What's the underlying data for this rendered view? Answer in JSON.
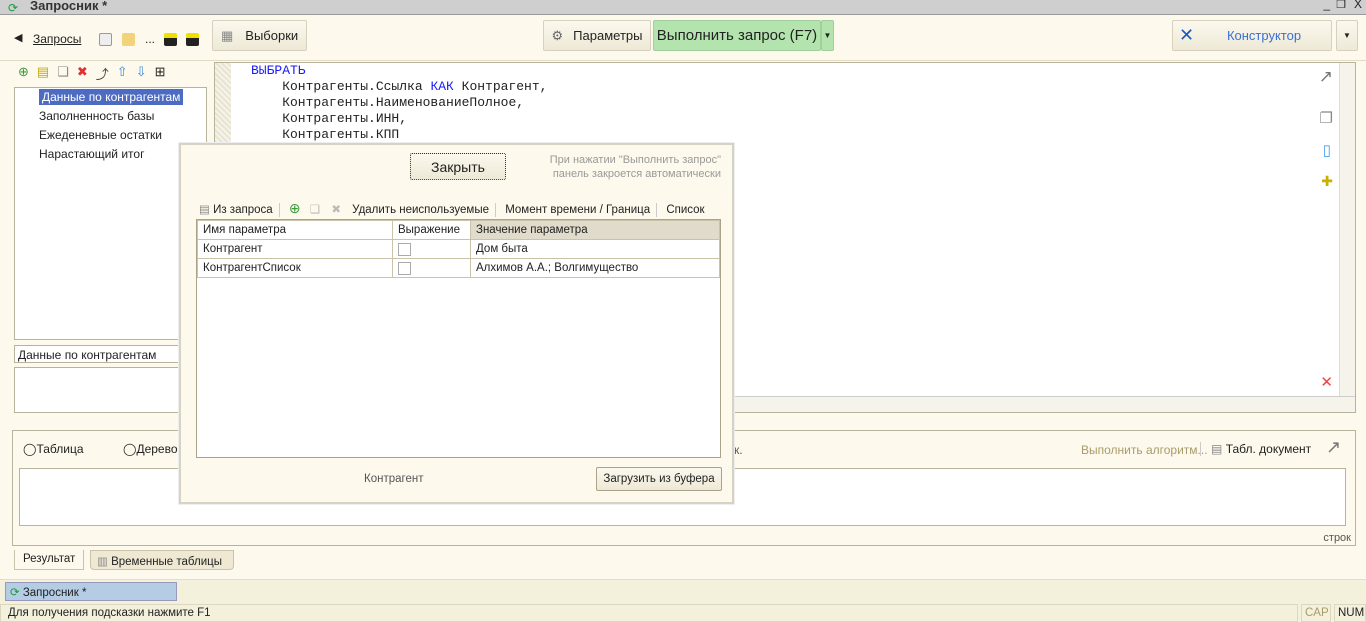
{
  "window": {
    "title": "Запросник *"
  },
  "toolbar": {
    "back_label": "Запросы",
    "dots": "...",
    "samples_label": "Выборки",
    "params_label": "Параметры",
    "run_label": "Выполнить запрос (F7)",
    "constructor_label": "Конструктор"
  },
  "tree": {
    "items": [
      "Данные по контрагентам",
      "Заполненность базы",
      "Ежеденевные остатки",
      "Нарастающий итог"
    ]
  },
  "query_name": "Данные по контрагентам",
  "editor": {
    "lines": [
      {
        "a": "ВЫБРАТЬ",
        "b": "",
        "c": ""
      },
      {
        "a": "    Контрагенты.Ссылка ",
        "b": "КАК",
        "c": " Контрагент,"
      },
      {
        "a": "    Контрагенты.НаименованиеПолное,",
        "b": "",
        "c": ""
      },
      {
        "a": "    Контрагенты.ИНН,",
        "b": "",
        "c": ""
      },
      {
        "a": "    Контрагенты.КПП",
        "b": "",
        "c": ""
      }
    ]
  },
  "result": {
    "radio_table": "Таблица",
    "radio_tree": "Дерево",
    "hidden_tail": "к.",
    "run_algorithm": "Выполнить алгоритм...",
    "spreadsheet": "Табл. документ",
    "rows_label": "строк"
  },
  "tabs": [
    "Результат",
    "Временные таблицы"
  ],
  "taskbar": {
    "item": "Запросник *"
  },
  "status": {
    "hint": "Для получения подсказки нажмите F1",
    "cap": "CAP",
    "num": "NUM"
  },
  "popup": {
    "close_label": "Закрыть",
    "note_line1": "При нажатии \"Выполнить запрос\"",
    "note_line2": "панель закроется автоматически",
    "from_query": "Из запроса",
    "delete_unused": "Удалить неиспользуемые",
    "moment": "Момент времени / Граница",
    "list": "Список",
    "columns": [
      "Имя параметра",
      "Выражение",
      "Значение параметра"
    ],
    "rows": [
      {
        "name": "Контрагент",
        "expr": false,
        "value": "Дом быта"
      },
      {
        "name": "КонтрагентСписок",
        "expr": false,
        "value": "Алхимов А.А.; Волгимущество"
      }
    ],
    "current_param": "Контрагент",
    "load_buffer": "Загрузить из буфера"
  }
}
